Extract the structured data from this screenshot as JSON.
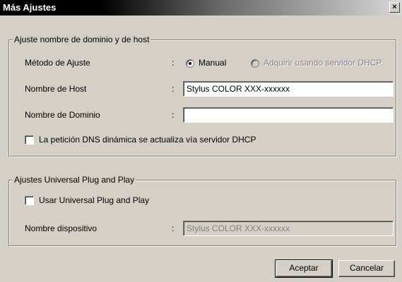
{
  "window": {
    "title": "Más Ajustes",
    "close_glyph": "×"
  },
  "group_dns": {
    "legend": "Ajuste nombre de dominio y de host",
    "method_label": "Método de Ajuste",
    "method_options": [
      {
        "label": "Manual",
        "selected": true,
        "enabled": true
      },
      {
        "label": "Adquirir usando servidor DHCP",
        "selected": false,
        "enabled": false
      }
    ],
    "host_label": "Nombre de Host",
    "host_value": "Stylus COLOR XXX-xxxxxx",
    "domain_label": "Nombre de Dominio",
    "domain_value": "",
    "dynamic_dns_label": "La petición DNS dinámica se actualiza vía servidor DHCP",
    "dynamic_dns_checked": false
  },
  "group_upnp": {
    "legend": "Ajustes Universal Plug and Play",
    "use_upnp_label": "Usar Universal Plug and Play",
    "use_upnp_checked": false,
    "device_name_label": "Nombre dispositivo",
    "device_name_value": "Stylus COLOR XXX-xxxxxx"
  },
  "colon": ":",
  "buttons": {
    "ok": "Aceptar",
    "cancel": "Cancelar"
  }
}
